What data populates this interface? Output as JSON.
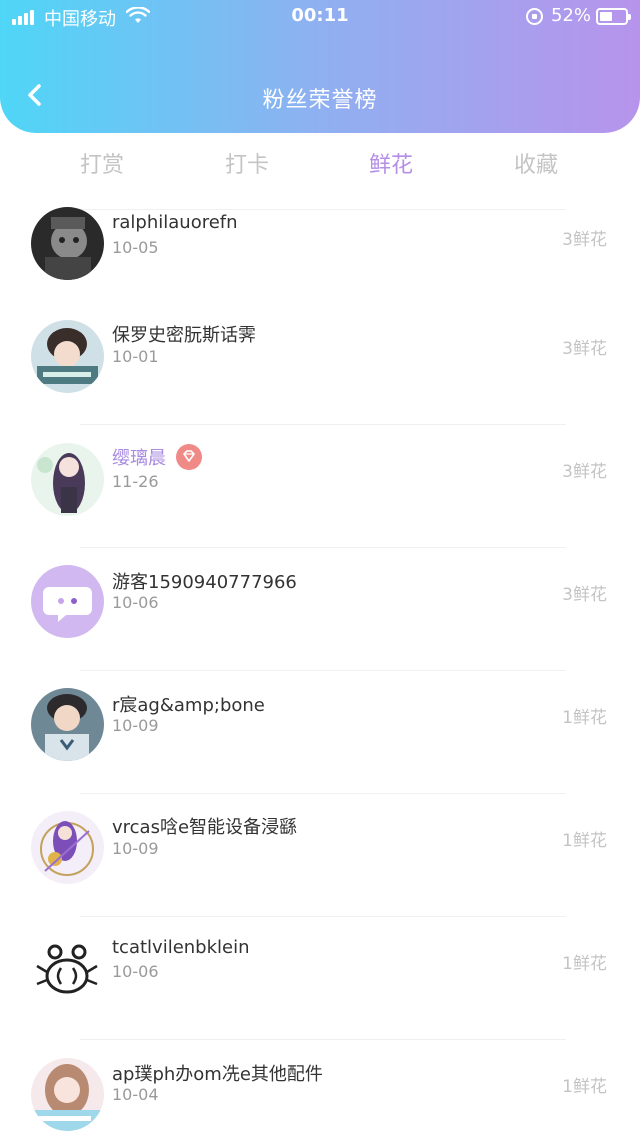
{
  "status_bar": {
    "carrier": "中国移动",
    "time": "00:11",
    "battery": "52%",
    "battery_level": 0.52
  },
  "header": {
    "title": "粉丝荣誉榜",
    "back_icon": "chevron-left-icon"
  },
  "tabs": [
    {
      "label": "打赏",
      "active": false
    },
    {
      "label": "打卡",
      "active": false
    },
    {
      "label": "鲜花",
      "active": true
    },
    {
      "label": "收藏",
      "active": false
    }
  ],
  "accent_color": "#b58ee6",
  "fans": [
    {
      "name": "ralphilauorefn",
      "date": "10-05",
      "count": "3鲜花",
      "vip": false
    },
    {
      "name": "保罗史密朊斯话霁",
      "date": "10-01",
      "count": "3鲜花",
      "vip": false
    },
    {
      "name": "缨璃晨",
      "date": "11-26",
      "count": "3鲜花",
      "vip": true
    },
    {
      "name": "游客1590940777966",
      "date": "10-06",
      "count": "3鲜花",
      "vip": false
    },
    {
      "name": "r宸ag&amp;bone",
      "date": "10-09",
      "count": "1鲜花",
      "vip": false
    },
    {
      "name": "vrcas唅e智能设备浸繇",
      "date": "10-09",
      "count": "1鲜花",
      "vip": false
    },
    {
      "name": "tcatlvilenbklein",
      "date": "10-06",
      "count": "1鲜花",
      "vip": false
    },
    {
      "name": "ap璞ph办om冼e其他配件",
      "date": "10-04",
      "count": "1鲜花",
      "vip": false
    }
  ]
}
